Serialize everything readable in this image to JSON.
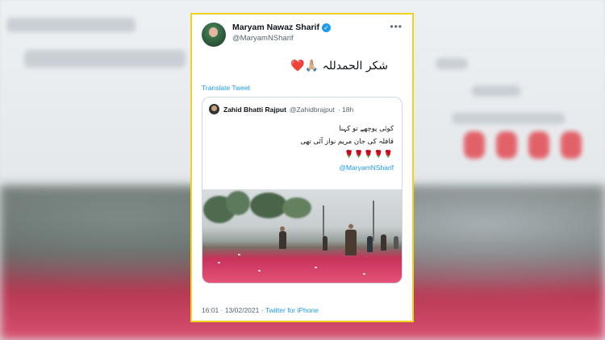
{
  "tweet": {
    "author_name": "Maryam Nawaz Sharif",
    "author_handle": "@MaryamNSharif",
    "more_icon": "•••",
    "text_urdu": "شکر الحمدللہ 🙏🏼❤️",
    "translate_label": "Translate Tweet",
    "timestamp": "16:01 · 13/02/2021",
    "separator": "·",
    "client": "Twitter for iPhone"
  },
  "quoted": {
    "author_name": "Zahid Bhatti Rajput",
    "author_handle": "@Zahidbrajput",
    "age": "· 18h",
    "line1": "کوئی پوچھے تو کہنا",
    "line2": "قافلہ کی جان مریم نواز آئی تھی",
    "hearts": "🌹🌹🌹🌹🌹",
    "mention": "@MaryamNSharif"
  },
  "colors": {
    "frame_border": "#f2d21b",
    "link_blue": "#1d9bf0",
    "text_primary": "#0f1419",
    "text_secondary": "#536471"
  }
}
